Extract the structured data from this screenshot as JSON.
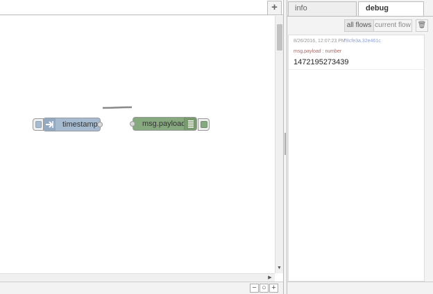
{
  "workspace": {
    "add_flow_icon": "+",
    "zoom_out_icon": "−",
    "zoom_reset_icon": "○",
    "zoom_in_icon": "+",
    "scroll_down_icon": "▼",
    "scroll_right_icon": "▶"
  },
  "nodes": {
    "inject": {
      "label": "timestamp",
      "icon": "arrow-in-icon",
      "color": "#a6bbcf"
    },
    "debug": {
      "label": "msg.payload",
      "icon": "list-icon",
      "color": "#87a980"
    }
  },
  "sidebar": {
    "tabs": [
      {
        "label": "info"
      },
      {
        "label": "debug"
      }
    ],
    "filters": {
      "all_flows": "all flows",
      "current_flow": "current flow",
      "clear_icon": "🗑"
    },
    "messages": [
      {
        "timestamp": "8/26/2016, 12:07:23 PM",
        "node_id": "78cfe3a.32e461c",
        "topic": "msg.payload : number",
        "value": "1472195273439"
      }
    ]
  }
}
